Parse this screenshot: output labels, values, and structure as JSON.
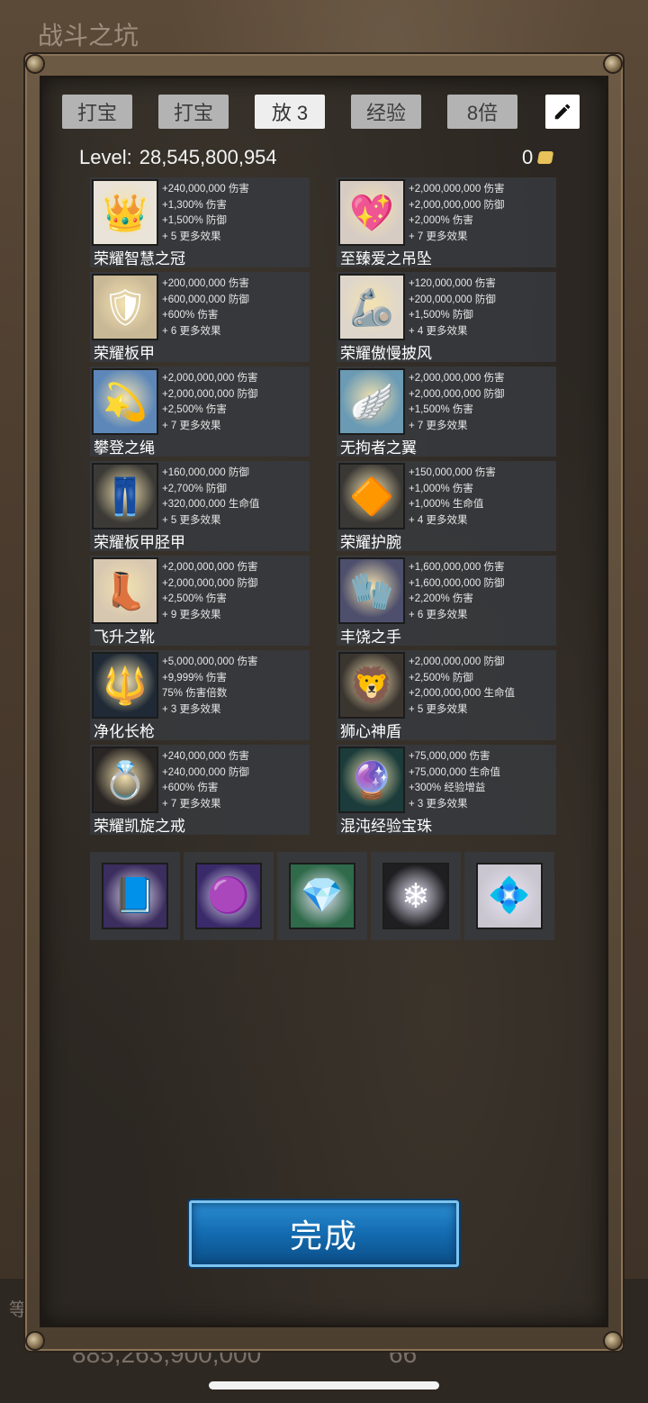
{
  "background": {
    "title": "战斗之坑",
    "bottom_number_left": "885,263,900,000",
    "bottom_number_right": "66",
    "side_text": "等"
  },
  "tabs": [
    {
      "label": "打宝"
    },
    {
      "label": "打宝"
    },
    {
      "label": "放 3",
      "active": true
    },
    {
      "label": "经验"
    },
    {
      "label": "8倍"
    }
  ],
  "header": {
    "level_label": "Level:",
    "level_value": "28,545,800,954",
    "gold_count": "0"
  },
  "items": [
    {
      "name": "荣耀智慧之冠",
      "icon": "crown-icon",
      "glyph": "👑",
      "bg": "#e9e3da",
      "stats": [
        "+240,000,000 伤害",
        "+1,300% 伤害",
        "+1,500% 防御",
        "+ 5 更多效果"
      ]
    },
    {
      "name": "至臻爱之吊坠",
      "icon": "heart-pendant-icon",
      "glyph": "💖",
      "bg": "#d7ccc4",
      "stats": [
        "+2,000,000,000 伤害",
        "+2,000,000,000 防御",
        "+2,000% 伤害",
        "+ 7 更多效果"
      ]
    },
    {
      "name": "荣耀板甲",
      "icon": "plate-armor-icon",
      "glyph": "🛡",
      "bg": "#c9b896",
      "stats": [
        "+200,000,000 伤害",
        "+600,000,000 防御",
        "+600% 伤害",
        "+ 6 更多效果"
      ]
    },
    {
      "name": "荣耀傲慢披风",
      "icon": "shoulder-armor-icon",
      "glyph": "🦾",
      "bg": "#ded6cb",
      "stats": [
        "+120,000,000 伤害",
        "+200,000,000 防御",
        "+1,500% 防御",
        "+ 4 更多效果"
      ]
    },
    {
      "name": "攀登之绳",
      "icon": "halo-rope-icon",
      "glyph": "💫",
      "bg": "#5d87b8",
      "stats": [
        "+2,000,000,000 伤害",
        "+2,000,000,000 防御",
        "+2,500% 伤害",
        "+ 7 更多效果"
      ]
    },
    {
      "name": "无拘者之翼",
      "icon": "wings-icon",
      "glyph": "🪽",
      "bg": "#6a9ab4",
      "stats": [
        "+2,000,000,000 伤害",
        "+2,000,000,000 防御",
        "+1,500% 伤害",
        "+ 7 更多效果"
      ]
    },
    {
      "name": "荣耀板甲胫甲",
      "icon": "greaves-icon",
      "glyph": "👖",
      "bg": "#3b3a36",
      "stats": [
        "+160,000,000 防御",
        "+2,700% 防御",
        "+320,000,000 生命值",
        "+ 5 更多效果"
      ]
    },
    {
      "name": "荣耀护腕",
      "icon": "bracer-icon",
      "glyph": "🔶",
      "bg": "#3a3835",
      "stats": [
        "+150,000,000 伤害",
        "+1,000% 伤害",
        "+1,000% 生命值",
        "+ 4 更多效果"
      ]
    },
    {
      "name": "飞升之靴",
      "icon": "winged-boots-icon",
      "glyph": "👢",
      "bg": "#d7c7b0",
      "stats": [
        "+2,000,000,000 伤害",
        "+2,000,000,000 防御",
        "+2,500% 伤害",
        "+ 9 更多效果"
      ]
    },
    {
      "name": "丰饶之手",
      "icon": "gauntlets-icon",
      "glyph": "🧤",
      "bg": "#4d4f6c",
      "stats": [
        "+1,600,000,000 伤害",
        "+1,600,000,000 防御",
        "+2,200% 伤害",
        "+ 6 更多效果"
      ]
    },
    {
      "name": "净化长枪",
      "icon": "spear-icon",
      "glyph": "🔱",
      "bg": "#1f2a36",
      "stats": [
        "+5,000,000,000 伤害",
        "+9,999% 伤害",
        "75% 伤害倍数",
        "+ 3 更多效果"
      ]
    },
    {
      "name": "狮心神盾",
      "icon": "lion-shield-icon",
      "glyph": "🦁",
      "bg": "#3b3530",
      "stats": [
        "+2,000,000,000 防御",
        "+2,500% 防御",
        "+2,000,000,000 生命值",
        "+ 5 更多效果"
      ]
    },
    {
      "name": "荣耀凯旋之戒",
      "icon": "ring-icon",
      "glyph": "💍",
      "bg": "#2a2624",
      "stats": [
        "+240,000,000 伤害",
        "+240,000,000 防御",
        "+600% 伤害",
        "+ 7 更多效果"
      ]
    },
    {
      "name": "混沌经验宝珠",
      "icon": "orb-icon",
      "glyph": "🔮",
      "bg": "#1b3c3a",
      "stats": [
        "+75,000,000 伤害",
        "+75,000,000 生命值",
        "+300% 经验增益",
        "+ 3 更多效果"
      ]
    }
  ],
  "gems": [
    {
      "icon": "spellbook-icon",
      "glyph": "📘",
      "bg": "#3b2d5e"
    },
    {
      "icon": "energy-orb-icon",
      "glyph": "🟣",
      "bg": "#3a2a6a"
    },
    {
      "icon": "emerald-gem-icon",
      "glyph": "💎",
      "bg": "#2f6a4a"
    },
    {
      "icon": "white-crystal-icon",
      "glyph": "❄",
      "bg": "#1f1f22"
    },
    {
      "icon": "crystal-cluster-icon",
      "glyph": "💠",
      "bg": "#c9c6cf"
    }
  ],
  "done_button": {
    "label": "完成",
    "color": "#1b74bb"
  }
}
